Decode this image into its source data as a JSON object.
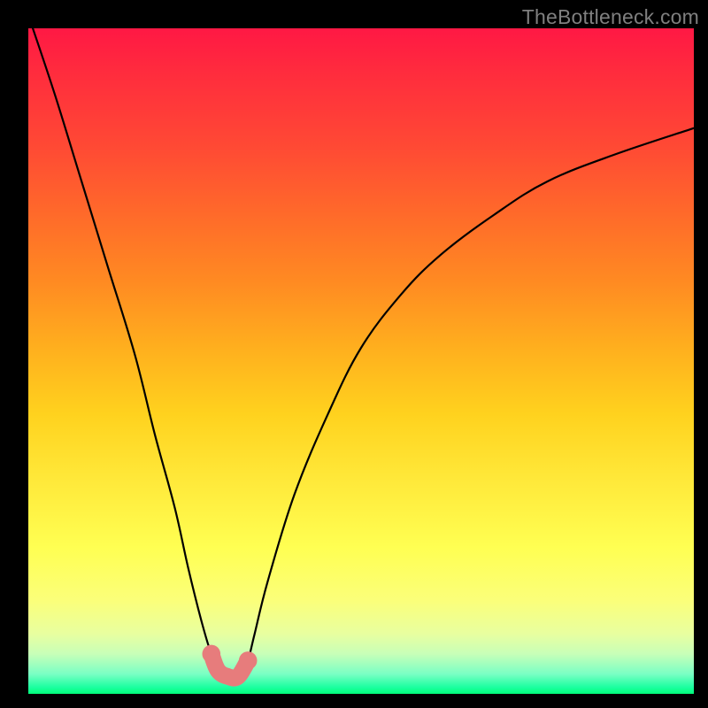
{
  "attribution": "TheBottleneck.com",
  "chart_data": {
    "type": "line",
    "title": "",
    "xlabel": "",
    "ylabel": "",
    "ylim": [
      0,
      100
    ],
    "xlim": [
      0,
      100
    ],
    "series": [
      {
        "name": "bottleneck-curve",
        "x": [
          0,
          4,
          8,
          12,
          16,
          19,
          22,
          24,
          26,
          27.5,
          29,
          30.5,
          32,
          33,
          34,
          36,
          40,
          45,
          50,
          56,
          62,
          70,
          78,
          88,
          100
        ],
        "values": [
          102,
          90,
          77,
          64,
          51,
          39,
          28,
          19,
          11,
          6,
          3,
          2.5,
          3,
          5,
          9,
          17,
          30,
          42,
          52,
          60,
          66,
          72,
          77,
          81,
          85
        ]
      }
    ],
    "highlight": {
      "name": "optimal-band",
      "color": "#e77c7c",
      "points": [
        {
          "x": 27.5,
          "y": 6.0
        },
        {
          "x": 28.5,
          "y": 3.5
        },
        {
          "x": 30.0,
          "y": 2.6
        },
        {
          "x": 31.5,
          "y": 2.6
        },
        {
          "x": 33.0,
          "y": 5.0
        }
      ],
      "stroke_width_pct": 2.5
    },
    "background_gradient": {
      "top": "#ff1844",
      "mid": "#ffe93a",
      "bottom": "#00ff7a"
    }
  }
}
